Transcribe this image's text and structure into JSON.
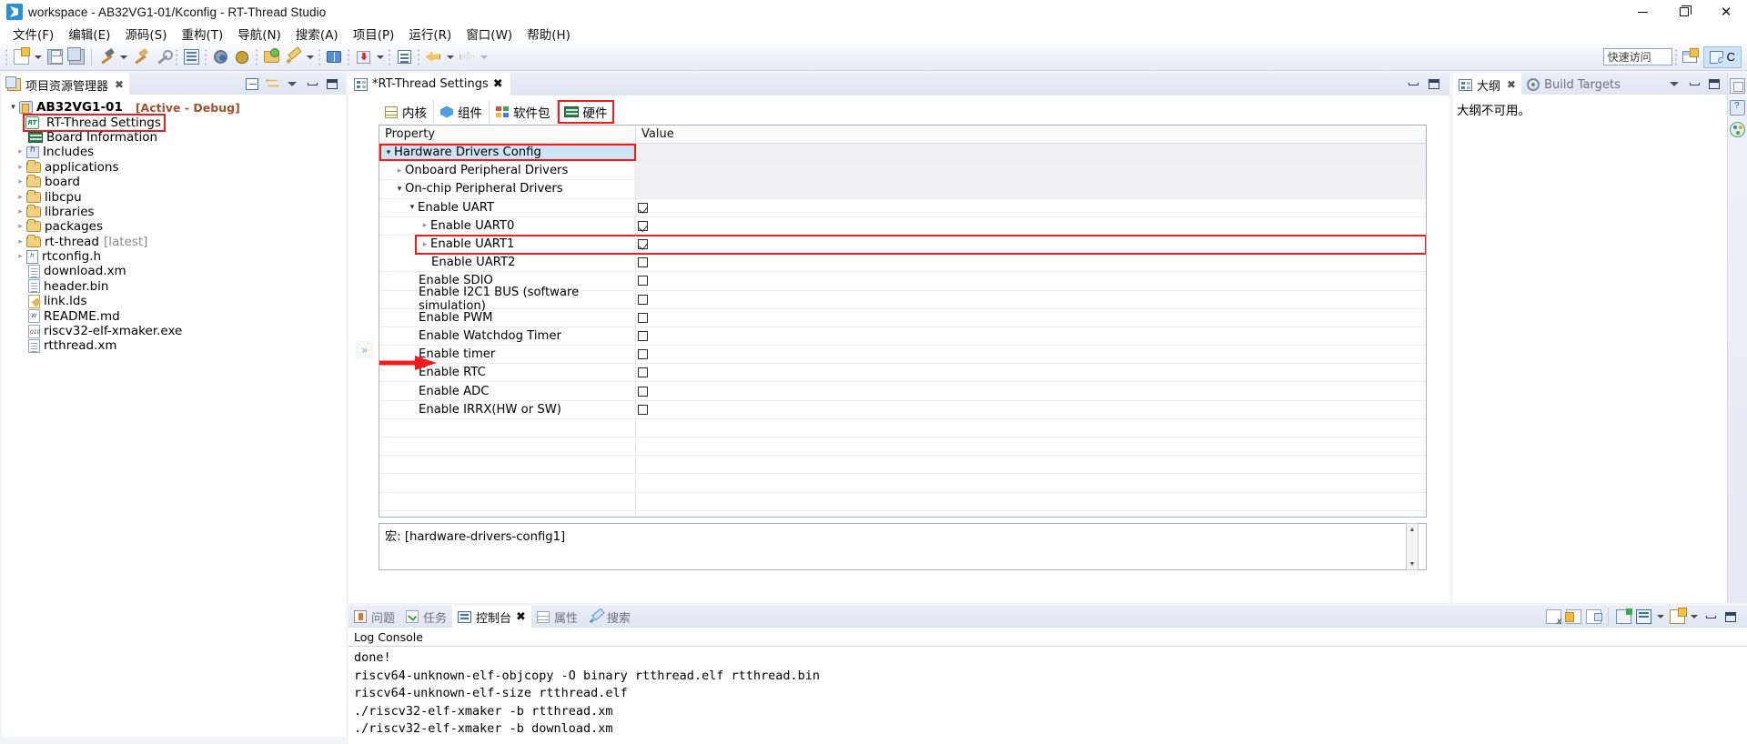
{
  "window": {
    "title": "workspace - AB32VG1-01/Kconfig - RT-Thread Studio",
    "app_icon": "rt-thread-studio-icon",
    "minimize": "—",
    "maximize": "❐",
    "close": "✕"
  },
  "menu": [
    {
      "label": "文件(F)",
      "name": "menu-file"
    },
    {
      "label": "编辑(E)",
      "name": "menu-edit"
    },
    {
      "label": "源码(S)",
      "name": "menu-source"
    },
    {
      "label": "重构(T)",
      "name": "menu-refactor"
    },
    {
      "label": "导航(N)",
      "name": "menu-navigate"
    },
    {
      "label": "搜索(A)",
      "name": "menu-search"
    },
    {
      "label": "项目(P)",
      "name": "menu-project"
    },
    {
      "label": "运行(R)",
      "name": "menu-run"
    },
    {
      "label": "窗口(W)",
      "name": "menu-window"
    },
    {
      "label": "帮助(H)",
      "name": "menu-help"
    }
  ],
  "toolbar": {
    "quick_access_placeholder": "快速访问",
    "perspective_c_label": "C",
    "icons": [
      "new-file-icon",
      "save-icon",
      "save-all-icon",
      "build-icon",
      "build-clean-icon",
      "wrench-icon",
      "terminal-icon",
      "settings-gear-icon",
      "debug-bug-icon",
      "open-folder-icon",
      "pencil-icon",
      "book-icon",
      "download-icon",
      "list-icon",
      "back-arrow-icon",
      "forward-arrow-icon"
    ]
  },
  "project_explorer": {
    "tab_label": "项目资源管理器",
    "tab_close": "✖",
    "tools": [
      "collapse-all-icon",
      "link-with-editor-icon",
      "view-menu-icon",
      "minimize-icon",
      "maximize-icon"
    ],
    "items": [
      {
        "label": "AB32VG1-01",
        "suffix": "[Active - Debug]",
        "indent": 0,
        "twisty": "open",
        "icon": "project-icon",
        "bold": true
      },
      {
        "label": "RT-Thread Settings",
        "indent": 1,
        "twisty": "none",
        "icon": "rt-thread-icon",
        "highlight": true
      },
      {
        "label": "Board Information",
        "indent": 1,
        "twisty": "none",
        "icon": "board-icon"
      },
      {
        "label": "Includes",
        "indent": 1,
        "twisty": "closed",
        "icon": "includes-icon"
      },
      {
        "label": "applications",
        "indent": 1,
        "twisty": "closed",
        "icon": "folder-icon"
      },
      {
        "label": "board",
        "indent": 1,
        "twisty": "closed",
        "icon": "folder-icon"
      },
      {
        "label": "libcpu",
        "indent": 1,
        "twisty": "closed",
        "icon": "folder-icon"
      },
      {
        "label": "libraries",
        "indent": 1,
        "twisty": "closed",
        "icon": "folder-icon"
      },
      {
        "label": "packages",
        "indent": 1,
        "twisty": "closed",
        "icon": "folder-icon"
      },
      {
        "label": "rt-thread",
        "suffix": "[latest]",
        "indent": 1,
        "twisty": "closed",
        "icon": "folder-icon"
      },
      {
        "label": "rtconfig.h",
        "indent": 1,
        "twisty": "closed",
        "icon": "header-file-icon"
      },
      {
        "label": "download.xm",
        "indent": 2,
        "twisty": "none",
        "icon": "file-icon"
      },
      {
        "label": "header.bin",
        "indent": 2,
        "twisty": "none",
        "icon": "file-icon"
      },
      {
        "label": "link.lds",
        "indent": 2,
        "twisty": "none",
        "icon": "lds-file-icon"
      },
      {
        "label": "README.md",
        "indent": 2,
        "twisty": "none",
        "icon": "markdown-file-icon"
      },
      {
        "label": "riscv32-elf-xmaker.exe",
        "indent": 2,
        "twisty": "none",
        "icon": "exe-file-icon"
      },
      {
        "label": "rtthread.xm",
        "indent": 2,
        "twisty": "none",
        "icon": "file-icon"
      }
    ]
  },
  "editor": {
    "tab_label": "*RT-Thread Settings",
    "tab_close": "✖",
    "config_tabs": [
      {
        "label": "内核",
        "icon": "kernel-icon",
        "selected": false
      },
      {
        "label": "组件",
        "icon": "components-icon",
        "selected": false
      },
      {
        "label": "软件包",
        "icon": "packages-icon",
        "selected": false
      },
      {
        "label": "硬件",
        "icon": "hardware-icon",
        "selected": true
      }
    ],
    "table": {
      "headers": [
        "Property",
        "Value"
      ],
      "rows": [
        {
          "label": "Hardware Drivers Config",
          "indent": 0,
          "twisty": "open",
          "value": "",
          "selected": true,
          "highlight": true,
          "shaded": true
        },
        {
          "label": "Onboard Peripheral Drivers",
          "indent": 1,
          "twisty": "closed",
          "value": "",
          "shaded": true
        },
        {
          "label": "On-chip Peripheral Drivers",
          "indent": 1,
          "twisty": "open",
          "value": "",
          "shaded": true
        },
        {
          "label": "Enable UART",
          "indent": 2,
          "twisty": "open",
          "value": "checked"
        },
        {
          "label": "Enable UART0",
          "indent": 3,
          "twisty": "closed",
          "value": "checked"
        },
        {
          "label": "Enable UART1",
          "indent": 3,
          "twisty": "closed",
          "value": "checked",
          "highlight": true
        },
        {
          "label": "Enable UART2",
          "indent": 3,
          "twisty": "none",
          "value": "unchecked"
        },
        {
          "label": "Enable SDIO",
          "indent": 2,
          "twisty": "none",
          "value": "unchecked"
        },
        {
          "label": "Enable I2C1 BUS (software simulation)",
          "indent": 2,
          "twisty": "none",
          "value": "unchecked"
        },
        {
          "label": "Enable PWM",
          "indent": 2,
          "twisty": "none",
          "value": "unchecked"
        },
        {
          "label": "Enable Watchdog Timer",
          "indent": 2,
          "twisty": "none",
          "value": "unchecked"
        },
        {
          "label": "Enable timer",
          "indent": 2,
          "twisty": "none",
          "value": "unchecked"
        },
        {
          "label": "Enable RTC",
          "indent": 2,
          "twisty": "none",
          "value": "unchecked"
        },
        {
          "label": "Enable ADC",
          "indent": 2,
          "twisty": "none",
          "value": "unchecked"
        },
        {
          "label": "Enable IRRX(HW or SW)",
          "indent": 2,
          "twisty": "none",
          "value": "unchecked"
        },
        {
          "label": "",
          "indent": 0,
          "twisty": "none",
          "value": ""
        },
        {
          "label": "",
          "indent": 0,
          "twisty": "none",
          "value": ""
        },
        {
          "label": "",
          "indent": 0,
          "twisty": "none",
          "value": ""
        },
        {
          "label": "",
          "indent": 0,
          "twisty": "none",
          "value": ""
        },
        {
          "label": "",
          "indent": 0,
          "twisty": "none",
          "value": ""
        },
        {
          "label": "",
          "indent": 0,
          "twisty": "none",
          "value": ""
        }
      ]
    },
    "macro_text": "宏: [hardware-drivers-config1]",
    "expand_chevron": "»"
  },
  "outline_view": {
    "tabs": [
      {
        "label": "大纲",
        "icon": "outline-icon",
        "selected": true,
        "close": "✖"
      },
      {
        "label": "Build Targets",
        "icon": "build-target-icon",
        "selected": false
      }
    ],
    "message": "大纲不可用。",
    "tools": [
      "view-menu-icon",
      "minimize-icon",
      "maximize-icon"
    ]
  },
  "console": {
    "tabs": [
      {
        "label": "问题",
        "icon": "problems-icon",
        "selected": false
      },
      {
        "label": "任务",
        "icon": "tasks-icon",
        "selected": false
      },
      {
        "label": "控制台",
        "icon": "console-icon",
        "selected": true,
        "close": "✖"
      },
      {
        "label": "属性",
        "icon": "properties-icon",
        "selected": false
      },
      {
        "label": "搜索",
        "icon": "search-icon",
        "selected": false
      }
    ],
    "tools": [
      "clear-console-icon",
      "lock-scroll-icon",
      "scroll-lock-icon",
      "display-selected-console-icon",
      "pin-console-icon",
      "open-console-icon",
      "minimize-icon",
      "maximize-icon"
    ],
    "title": "Log Console",
    "lines": [
      "done!",
      "riscv64-unknown-elf-objcopy -O binary rtthread.elf rtthread.bin",
      "riscv64-unknown-elf-size rtthread.elf",
      "./riscv32-elf-xmaker -b rtthread.xm",
      "./riscv32-elf-xmaker -b download.xm"
    ]
  },
  "colors": {
    "accent_red": "#ee1c1c",
    "selection_blue": "#cfe3f5",
    "tab_gradient_top": "#e9eef7",
    "tab_gradient_bottom": "#dfe6f2"
  }
}
